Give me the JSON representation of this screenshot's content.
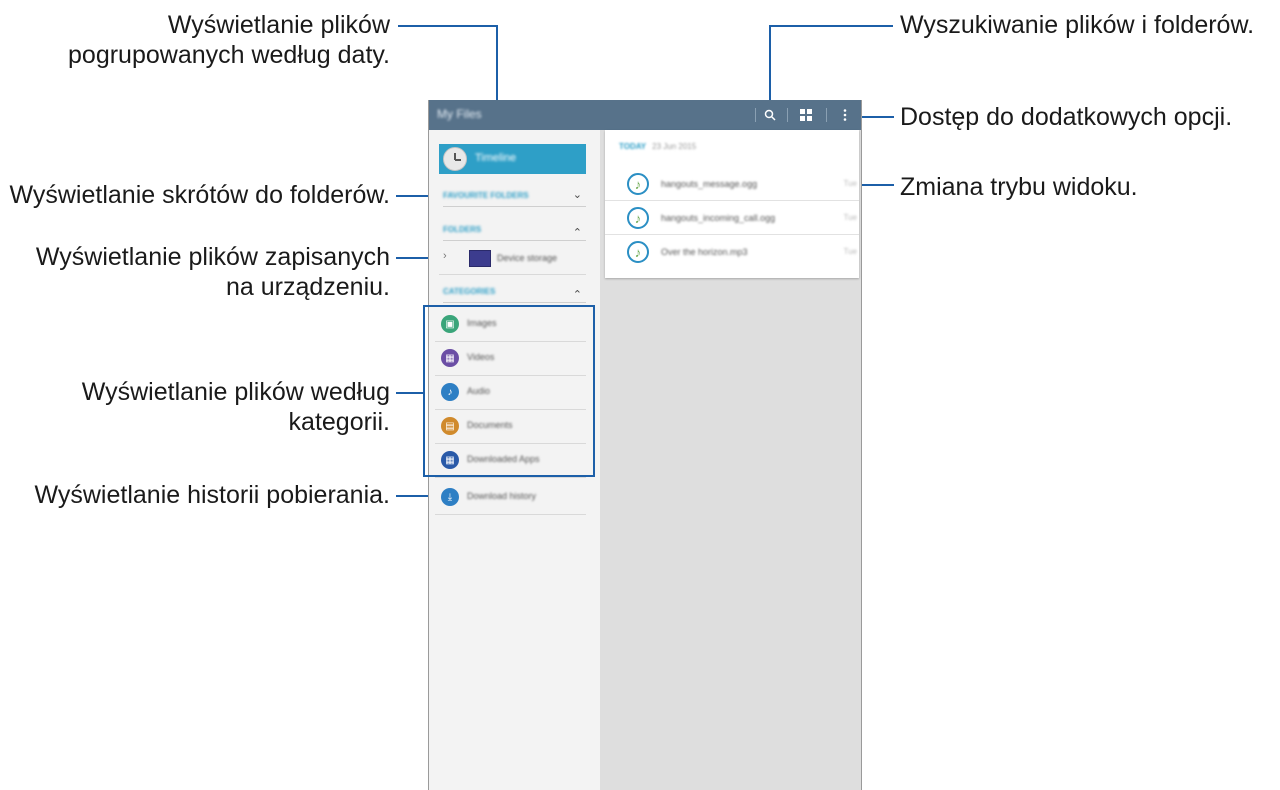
{
  "annotations": {
    "timeline": "Wyświetlanie plików\npogrupowanych według daty.",
    "favourites": "Wyświetlanie skrótów do folderów.",
    "device_storage": "Wyświetlanie plików zapisanych\nna urządzeniu.",
    "categories": "Wyświetlanie plików według\nkategorii.",
    "download_history": "Wyświetlanie historii pobierania.",
    "search": "Wyszukiwanie plików i folderów.",
    "more_options": "Dostęp do dodatkowych opcji.",
    "view_mode": "Zmiana trybu widoku."
  },
  "app": {
    "title": "My Files",
    "search_icon": "search-icon",
    "view_icon": "grid-view-icon",
    "menu_icon": "more-options-icon"
  },
  "sidebar": {
    "timeline_label": "Timeline",
    "favourite_header": "FAVOURITE FOLDERS",
    "folders_header": "FOLDERS",
    "device_storage_label": "Device storage",
    "categories_header": "CATEGORIES",
    "categories": [
      {
        "label": "Images",
        "icon": "image-icon",
        "color": "#3aa57a"
      },
      {
        "label": "Videos",
        "icon": "video-icon",
        "color": "#6b4ea5"
      },
      {
        "label": "Audio",
        "icon": "music-note-icon",
        "color": "#2e7fc4"
      },
      {
        "label": "Documents",
        "icon": "document-icon",
        "color": "#d08a2c"
      },
      {
        "label": "Downloaded Apps",
        "icon": "apps-icon",
        "color": "#2a5aa8"
      }
    ],
    "download_history_label": "Download history",
    "download_history_color": "#2e7fc4"
  },
  "content": {
    "day_label": "TODAY",
    "date_label": "23 Jun 2015",
    "files": [
      {
        "name": "hangouts_message.ogg",
        "meta": "Tue"
      },
      {
        "name": "hangouts_incoming_call.ogg",
        "meta": "Tue"
      },
      {
        "name": "Over the horizon.mp3",
        "meta": "Tue"
      }
    ]
  },
  "colors": {
    "action_bar": "#57728a",
    "accent": "#2e9fc7",
    "callout_line": "#1c5fa8"
  }
}
